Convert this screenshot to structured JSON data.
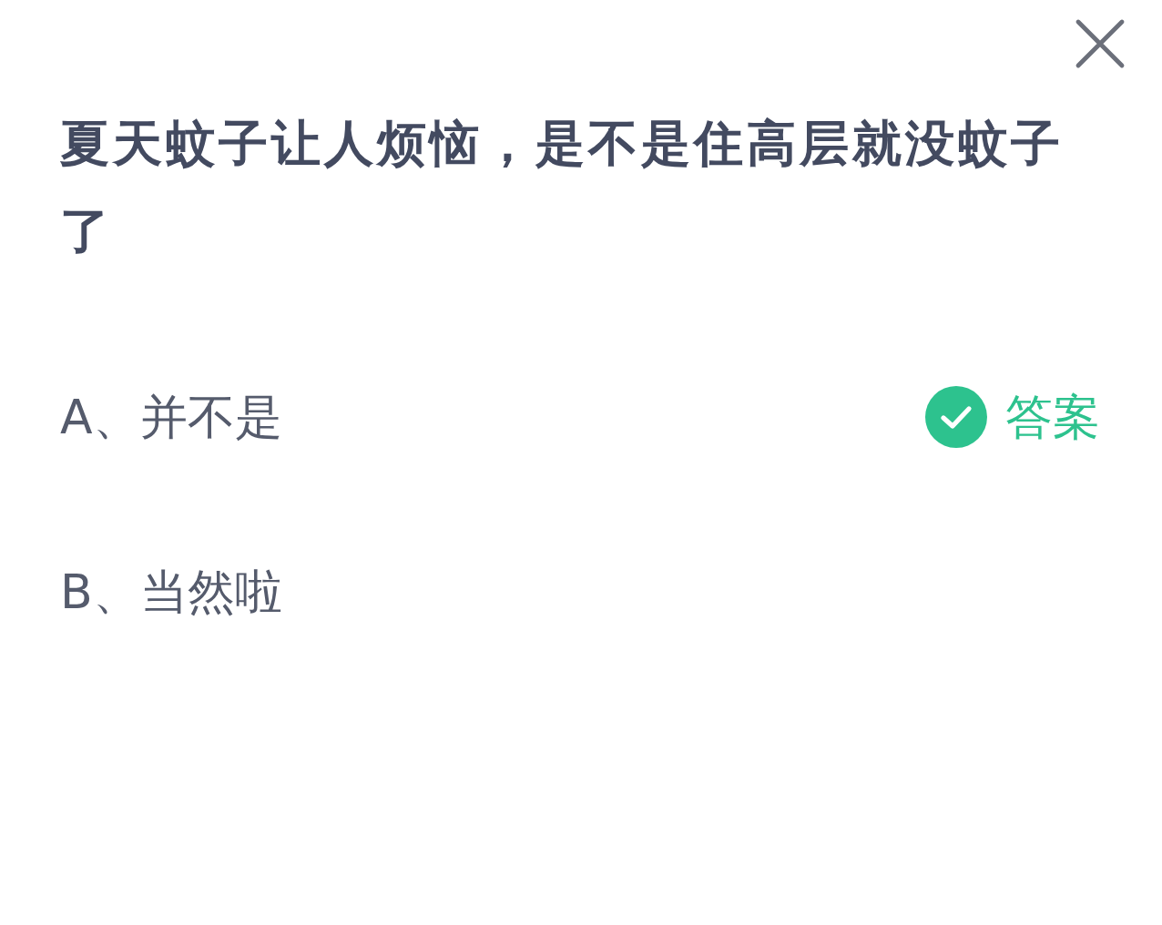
{
  "question": "夏天蚊子让人烦恼，是不是住高层就没蚊子了",
  "options": [
    {
      "text": "A、并不是",
      "correct": true,
      "badge": "答案"
    },
    {
      "text": "B、当然啦",
      "correct": false
    }
  ]
}
